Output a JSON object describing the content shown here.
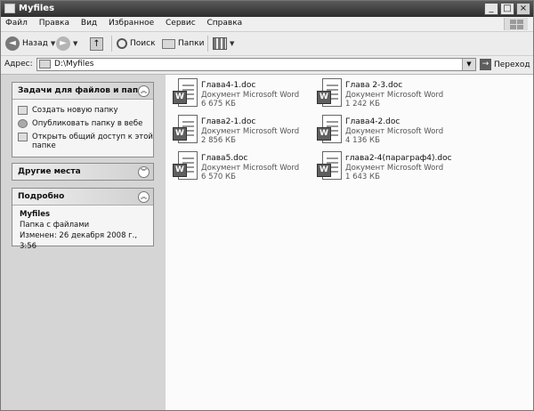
{
  "window": {
    "title": "Myfiles"
  },
  "menu": [
    "Файл",
    "Правка",
    "Вид",
    "Избранное",
    "Сервис",
    "Справка"
  ],
  "toolbar": {
    "back_label": "Назад",
    "search_label": "Поиск",
    "folders_label": "Папки"
  },
  "address": {
    "label": "Адрес:",
    "value": "D:\\Myfiles",
    "go_label": "Переход"
  },
  "tasks_panel": {
    "title": "Задачи для файлов и папок",
    "items": [
      "Создать новую папку",
      "Опубликовать папку в вебе",
      "Открыть общий доступ к этой папке"
    ]
  },
  "places_panel": {
    "title": "Другие места"
  },
  "details_panel": {
    "title": "Подробно",
    "name": "Myfiles",
    "type": "Папка с файлами",
    "modified": "Изменен: 26 декабря 2008 г., 3:56"
  },
  "files": [
    {
      "name": "Глава4-1.doc",
      "type": "Документ Microsoft Word",
      "size": "6 675 КБ"
    },
    {
      "name": "Глава 2-3.doc",
      "type": "Документ Microsoft Word",
      "size": "1 242 КБ"
    },
    {
      "name": "Глава2-1.doc",
      "type": "Документ Microsoft Word",
      "size": "2 856 КБ"
    },
    {
      "name": "Глава4-2.doc",
      "type": "Документ Microsoft Word",
      "size": "4 136 КБ"
    },
    {
      "name": "Глава5.doc",
      "type": "Документ Microsoft Word",
      "size": "6 570 КБ"
    },
    {
      "name": "глава2-4(параграф4).doc",
      "type": "Документ Microsoft Word",
      "size": "1 643 КБ"
    }
  ]
}
